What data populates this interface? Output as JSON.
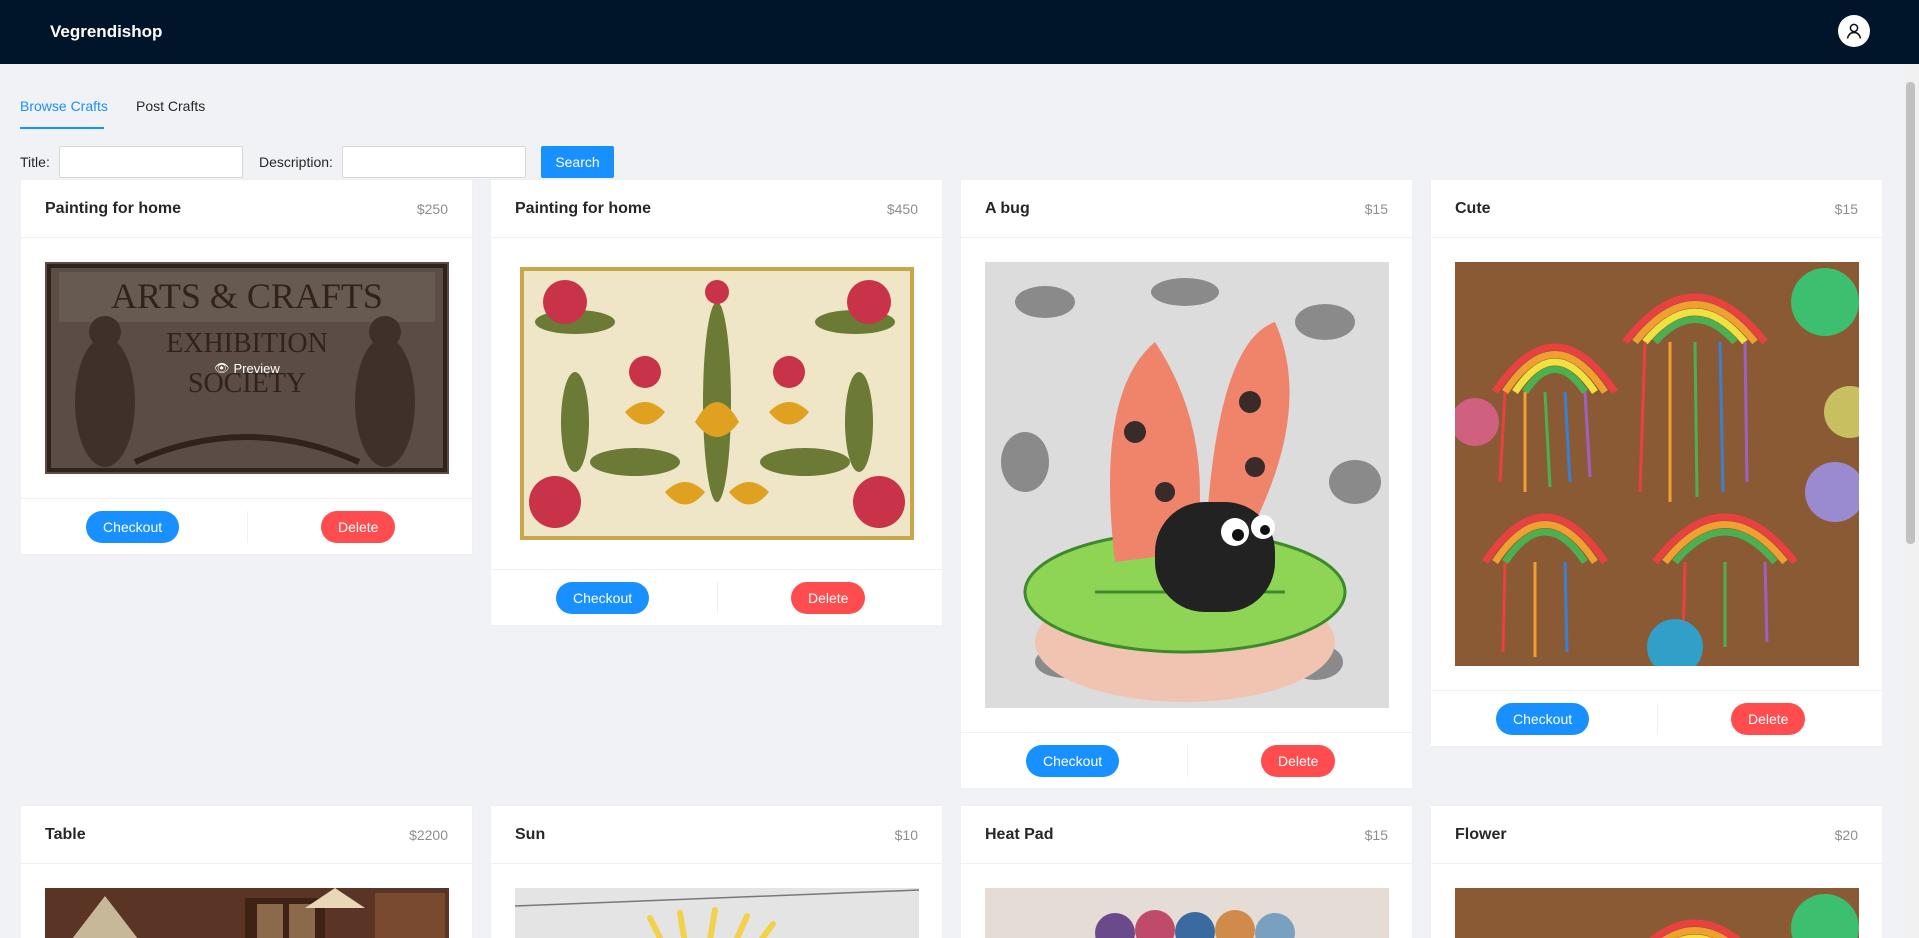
{
  "app": {
    "brand": "Vegrendishop"
  },
  "tabs": [
    {
      "label": "Browse Crafts",
      "active": true
    },
    {
      "label": "Post Crafts",
      "active": false
    }
  ],
  "search": {
    "title_label": "Title",
    "description_label": "Description",
    "title_value": "",
    "description_value": "",
    "button_label": "Search"
  },
  "actions": {
    "checkout": "Checkout",
    "delete": "Delete",
    "preview": "Preview"
  },
  "crafts": [
    {
      "title": "Painting for home",
      "price": "$250"
    },
    {
      "title": "Painting for home",
      "price": "$450"
    },
    {
      "title": "A bug",
      "price": "$15"
    },
    {
      "title": "Cute",
      "price": "$15"
    },
    {
      "title": "Table",
      "price": "$2200"
    },
    {
      "title": "Sun",
      "price": "$10"
    },
    {
      "title": "Heat Pad",
      "price": "$15"
    },
    {
      "title": "Flower",
      "price": "$20"
    }
  ],
  "colors": {
    "header": "#001529",
    "primary": "#1890ff",
    "danger": "#ff4d4f",
    "background": "#f0f2f5"
  }
}
